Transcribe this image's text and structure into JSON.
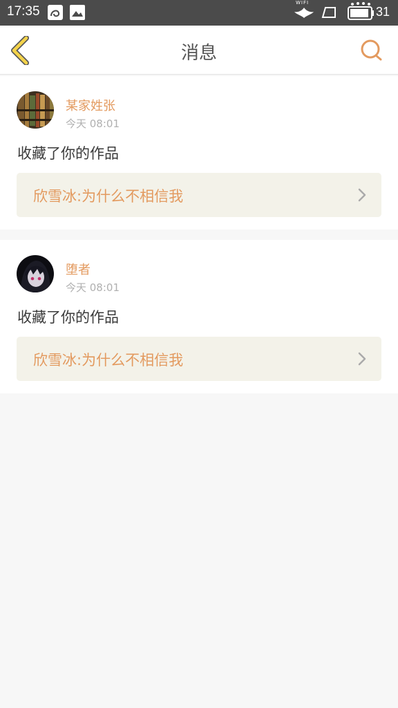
{
  "status_bar": {
    "time": "17:35",
    "wifi_label": "WIFI",
    "battery": "31"
  },
  "header": {
    "title": "消息"
  },
  "icons": {
    "back": "chevron-left-icon",
    "search": "search-icon",
    "more": "chevron-right-icon"
  },
  "colors": {
    "accent": "#e39a5f",
    "back_fill": "#f4d34a",
    "status_bar": "#4b4b4b",
    "work_bg": "#f3f2e9"
  },
  "messages": [
    {
      "username": "某家姓张",
      "time": "今天 08:01",
      "action": "收藏了你的作品",
      "work_title": "欣雪冰:为什么不相信我"
    },
    {
      "username": "堕者",
      "time": "今天 08:01",
      "action": "收藏了你的作品",
      "work_title": "欣雪冰:为什么不相信我"
    }
  ]
}
